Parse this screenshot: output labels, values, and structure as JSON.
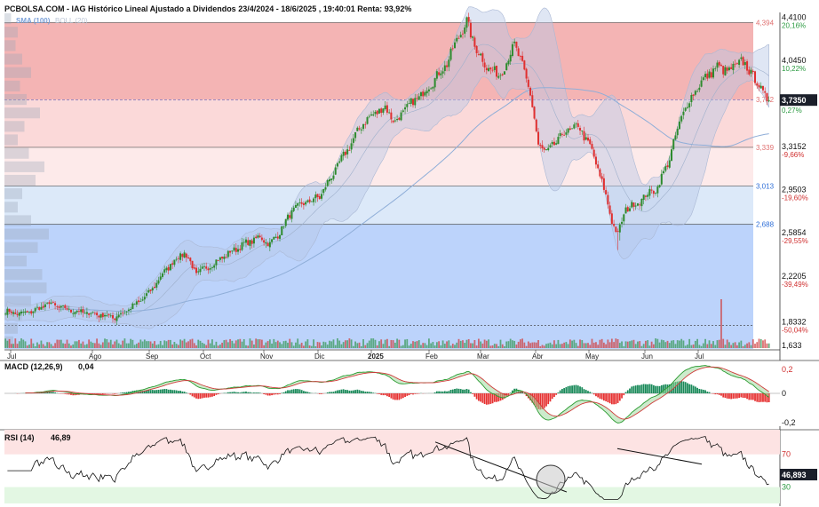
{
  "header": {
    "title": "PCBOLSA.COM - IAG Histórico Lineal Ajustado a Dividendos 23/4/2024 - 18/6/2025 , 19:40:01 Renta: 93,92%",
    "indicators": [
      "SMA (100)",
      "BOLL (20)"
    ]
  },
  "colors": {
    "up": "#2e8b2e",
    "down": "#e03030",
    "zone_red": "#f4b4b4",
    "zone_pink": "#fbd9d9",
    "zone_lightblue": "#dce9f9",
    "zone_blue": "#bcd3fb",
    "boll_band": "#b8c8e6",
    "sma": "#8faed8",
    "last_price_bg": "#1b1f2a",
    "macd_green": "#1a8a5a",
    "macd_red": "#e63232"
  },
  "chart_data": [
    {
      "type": "candlestick",
      "name": "price",
      "x_ticks": [
        "Jul",
        "Ago",
        "Sep",
        "Oct",
        "Nov",
        "Dic",
        "2025",
        "Feb",
        "Mar",
        "Abr",
        "May",
        "Jun",
        "Jul"
      ],
      "price_axis_ticks": [
        {
          "price": "4,4100",
          "pct": "20,16%"
        },
        {
          "price": "4,0450",
          "pct": "10,22%"
        },
        {
          "price": "3,7350",
          "pct": "0,27%"
        },
        {
          "price": "3,3152",
          "pct": "-9,66%"
        },
        {
          "price": "2,9503",
          "pct": "-19,60%"
        },
        {
          "price": "2,5854",
          "pct": "-29,55%"
        },
        {
          "price": "2,2205",
          "pct": "-39,49%"
        },
        {
          "price": "1,8332",
          "pct": "-50,04%"
        },
        {
          "price": "1,633",
          "pct": ""
        }
      ],
      "levels": [
        {
          "label": "4,394",
          "value": 4.394,
          "color": "#e07070"
        },
        {
          "label": "3,742",
          "value": 3.742,
          "color": "#e07070"
        },
        {
          "label": "3,339",
          "value": 3.339,
          "color": "#e07070"
        },
        {
          "label": "3,013",
          "value": 3.013,
          "color": "#2f6fd8"
        },
        {
          "label": "2,688",
          "value": 2.688,
          "color": "#2f6fd8"
        }
      ],
      "last_price": {
        "label": "3,7350",
        "value": 3.735
      },
      "ylim": [
        1.633,
        4.48
      ],
      "close_anchors": [
        [
          0,
          1.95
        ],
        [
          8,
          1.93
        ],
        [
          15,
          1.96
        ],
        [
          22,
          2.02
        ],
        [
          28,
          1.98
        ],
        [
          36,
          1.95
        ],
        [
          45,
          1.93
        ],
        [
          55,
          1.9
        ],
        [
          64,
          1.99
        ],
        [
          72,
          2.1
        ],
        [
          80,
          2.29
        ],
        [
          86,
          2.4
        ],
        [
          90,
          2.45
        ],
        [
          96,
          2.27
        ],
        [
          104,
          2.35
        ],
        [
          112,
          2.44
        ],
        [
          120,
          2.52
        ],
        [
          128,
          2.58
        ],
        [
          133,
          2.52
        ],
        [
          137,
          2.6
        ],
        [
          145,
          2.82
        ],
        [
          152,
          2.88
        ],
        [
          158,
          2.92
        ],
        [
          166,
          3.15
        ],
        [
          173,
          3.35
        ],
        [
          180,
          3.55
        ],
        [
          186,
          3.63
        ],
        [
          191,
          3.68
        ],
        [
          196,
          3.55
        ],
        [
          202,
          3.68
        ],
        [
          209,
          3.78
        ],
        [
          216,
          3.92
        ],
        [
          222,
          4.05
        ],
        [
          228,
          4.28
        ],
        [
          232,
          4.4
        ],
        [
          236,
          4.2
        ],
        [
          242,
          4.02
        ],
        [
          248,
          3.95
        ],
        [
          252,
          4.05
        ],
        [
          256,
          4.22
        ],
        [
          260,
          4.02
        ],
        [
          264,
          3.8
        ],
        [
          268,
          3.35
        ],
        [
          273,
          3.3
        ],
        [
          280,
          3.45
        ],
        [
          288,
          3.52
        ],
        [
          294,
          3.35
        ],
        [
          300,
          3.05
        ],
        [
          305,
          2.72
        ],
        [
          308,
          2.6
        ],
        [
          312,
          2.82
        ],
        [
          317,
          2.86
        ],
        [
          322,
          2.93
        ],
        [
          328,
          3.0
        ],
        [
          334,
          3.25
        ],
        [
          340,
          3.6
        ],
        [
          346,
          3.8
        ],
        [
          352,
          3.93
        ],
        [
          358,
          4.02
        ],
        [
          364,
          3.98
        ],
        [
          370,
          4.07
        ],
        [
          376,
          3.95
        ],
        [
          380,
          3.82
        ],
        [
          384,
          3.735
        ]
      ],
      "volume_spike": {
        "bar": 360,
        "relative": 1.0
      }
    },
    {
      "type": "line",
      "name": "MACD",
      "title": "MACD (12,26,9)",
      "value": "0,04",
      "y_ticks": [
        "0,2",
        "0",
        "-0,2"
      ],
      "ylim": [
        -0.22,
        0.22
      ]
    },
    {
      "type": "line",
      "name": "RSI",
      "title": "RSI (14)",
      "value": "46,89",
      "last_label": "46,893",
      "y_ticks": [
        "70",
        "30"
      ],
      "ylim": [
        10,
        100
      ],
      "levels": [
        70,
        30
      ]
    }
  ]
}
